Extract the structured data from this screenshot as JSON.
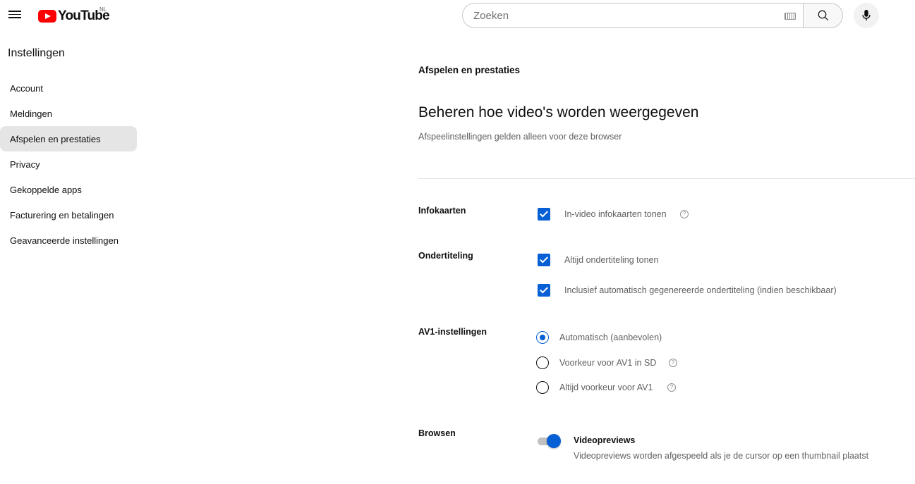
{
  "header": {
    "logo_text": "YouTube",
    "region": "NL",
    "search_placeholder": "Zoeken"
  },
  "sidebar": {
    "title": "Instellingen",
    "items": [
      {
        "label": "Account"
      },
      {
        "label": "Meldingen"
      },
      {
        "label": "Afspelen en prestaties",
        "active": true
      },
      {
        "label": "Privacy"
      },
      {
        "label": "Gekoppelde apps"
      },
      {
        "label": "Facturering en betalingen"
      },
      {
        "label": "Geavanceerde instellingen"
      }
    ]
  },
  "main": {
    "section_title": "Afspelen en prestaties",
    "heading": "Beheren hoe video's worden weergegeven",
    "subheading": "Afspeelinstellingen gelden alleen voor deze browser",
    "infocards": {
      "label": "Infokaarten",
      "option": "In-video infokaarten tonen",
      "checked": true
    },
    "subtitles": {
      "label": "Ondertiteling",
      "options": [
        {
          "label": "Altijd ondertiteling tonen",
          "checked": true
        },
        {
          "label": "Inclusief automatisch gegenereerde ondertiteling (indien beschikbaar)",
          "checked": true
        }
      ]
    },
    "av1": {
      "label": "AV1-instellingen",
      "options": [
        {
          "label": "Automatisch (aanbevolen)",
          "selected": true
        },
        {
          "label": "Voorkeur voor AV1 in SD",
          "selected": false
        },
        {
          "label": "Altijd voorkeur voor AV1",
          "selected": false
        }
      ]
    },
    "browse": {
      "label": "Browsen",
      "toggle_title": "Videopreviews",
      "toggle_desc": "Videopreviews worden afgespeeld als je de cursor op een thumbnail plaatst",
      "enabled": true
    }
  },
  "colors": {
    "accent": "#065fd4",
    "brand": "#ff0000",
    "active_bg": "#e5e5e5"
  }
}
